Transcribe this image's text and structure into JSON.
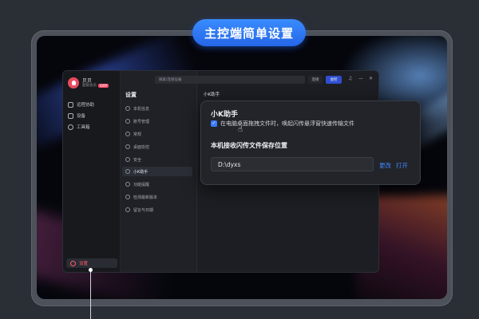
{
  "banner": {
    "title": "主控端简单设置"
  },
  "app": {
    "profile": {
      "name": "贝贝",
      "subtitle": "超级会员",
      "badge": "SVIP"
    },
    "nav": {
      "items": [
        {
          "label": "远程协助",
          "icon": "remote-icon"
        },
        {
          "label": "设备",
          "icon": "monitor-icon"
        },
        {
          "label": "工具箱",
          "icon": "toolbox-icon"
        }
      ],
      "settings_label": "设置"
    },
    "menu": {
      "title": "设置",
      "items": [
        {
          "label": "本机信息",
          "active": false
        },
        {
          "label": "账号管理",
          "active": false
        },
        {
          "label": "常规",
          "active": false
        },
        {
          "label": "桌面协控",
          "active": false
        },
        {
          "label": "安全",
          "active": false
        },
        {
          "label": "小K助手",
          "active": true
        },
        {
          "label": "功能提醒",
          "active": false
        },
        {
          "label": "检测最新版本",
          "active": false
        },
        {
          "label": "留言与日期",
          "active": false
        }
      ]
    },
    "topbar": {
      "search_placeholder": "搜索/连接设备",
      "btn_a": "连接",
      "btn_b": "会控",
      "ctrl_bell": "♫",
      "ctrl_min": "—",
      "ctrl_close": "✕"
    },
    "content_title": "小K助手"
  },
  "popup": {
    "heading": "小K助手",
    "checkbox_checked": true,
    "checkbox_label": "在电脑桌面拖拽文件时，唤起闪传悬浮窗快速传输文件",
    "save_heading": "本机接收闪传文件保存位置",
    "path_value": "D:\\dyxs",
    "link_change": "更改",
    "link_open": "打开"
  },
  "colors": {
    "accent": "#3a7afe",
    "banner": "#2566e8",
    "danger": "#ff5f6f"
  }
}
